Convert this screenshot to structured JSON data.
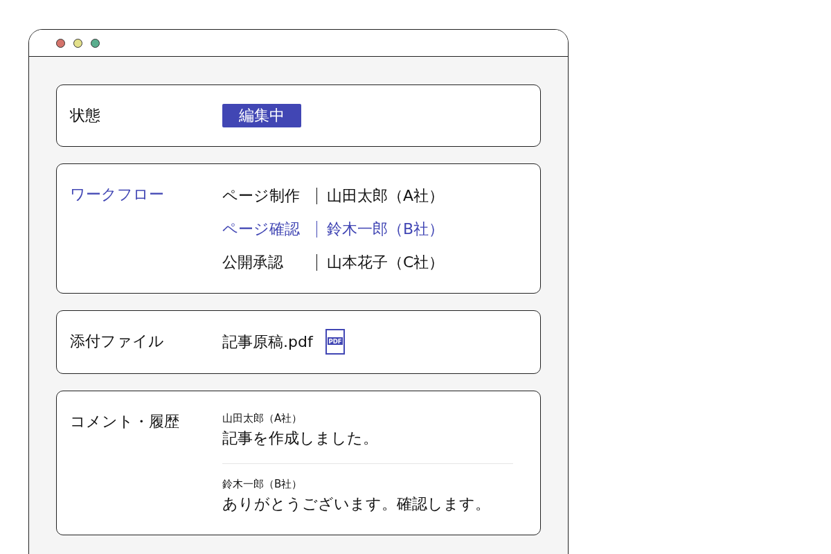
{
  "window": {
    "controls": [
      {
        "color": "#d4736b"
      },
      {
        "color": "#e3e08a"
      },
      {
        "color": "#5aae8e"
      }
    ]
  },
  "status": {
    "label": "状態",
    "badge": "編集中"
  },
  "workflow": {
    "label": "ワークフロー",
    "steps": [
      {
        "step": "ページ制作",
        "person": "山田太郎（A社）",
        "current": false
      },
      {
        "step": "ページ確認",
        "person": "鈴木一郎（B社）",
        "current": true
      },
      {
        "step": "公開承認",
        "person": "山本花子（C社）",
        "current": false
      }
    ]
  },
  "attachment": {
    "label": "添付ファイル",
    "file": "記事原稿.pdf",
    "icon_text": "PDF"
  },
  "comments": {
    "label": "コメント・履歴",
    "items": [
      {
        "author": "山田太郎（A社）",
        "text": "記事を作成しました。"
      },
      {
        "author": "鈴木一郎（B社）",
        "text": "ありがとうございます。確認します。"
      }
    ]
  }
}
